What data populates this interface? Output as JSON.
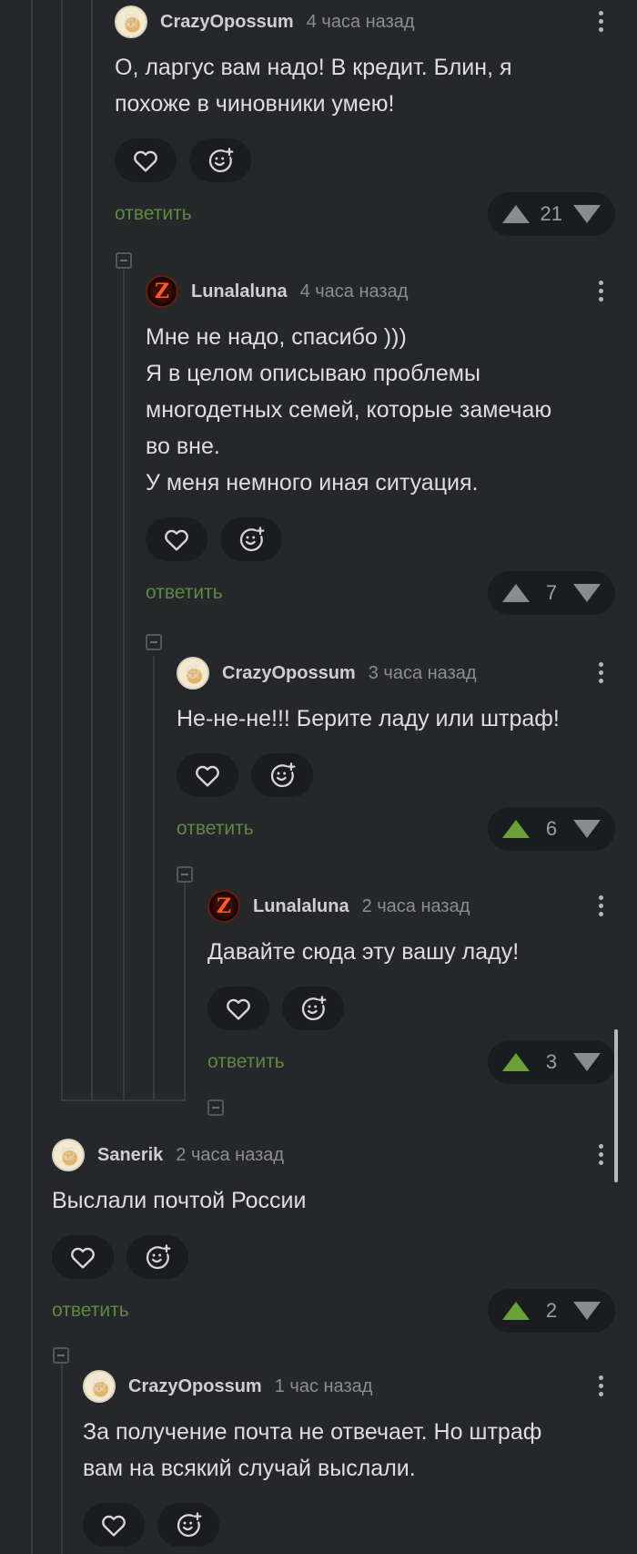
{
  "comments": [
    {
      "author": "CrazyOpossum",
      "time": "4 часа назад",
      "avatar": "possum-avatar",
      "lines": [
        "О, ларгус вам надо! В кредит. Блин, я",
        "похоже в чиновники умею!"
      ],
      "reply": "ответить",
      "rating": "21",
      "upvoted": false
    },
    {
      "author": "Lunalaluna",
      "time": "4 часа назад",
      "avatar": "z-logo-avatar",
      "avatar_letter": "Z",
      "lines": [
        "Мне не надо, спасибо )))",
        "Я в целом описываю проблемы",
        "многодетных семей, которые замечаю",
        "во вне.",
        "У меня немного иная ситуация."
      ],
      "reply": "ответить",
      "rating": "7",
      "upvoted": false
    },
    {
      "author": "CrazyOpossum",
      "time": "3 часа назад",
      "avatar": "possum-avatar",
      "lines": [
        "Не-не-не!!! Берите ладу или штраф!"
      ],
      "reply": "ответить",
      "rating": "6",
      "upvoted": true
    },
    {
      "author": "Lunalaluna",
      "time": "2 часа назад",
      "avatar": "z-logo-avatar",
      "avatar_letter": "Z",
      "lines": [
        "Давайте сюда эту вашу ладу!"
      ],
      "reply": "ответить",
      "rating": "3",
      "upvoted": true
    },
    {
      "author": "Sanerik",
      "time": "2 часа назад",
      "avatar": "possum-avatar",
      "lines": [
        "Выслали почтой России"
      ],
      "reply": "ответить",
      "rating": "2",
      "upvoted": true
    },
    {
      "author": "CrazyOpossum",
      "time": "1 час назад",
      "avatar": "possum-avatar",
      "lines": [
        "За получение почта не отвечает. Но штраф",
        "вам на всякий случай выслали."
      ]
    }
  ],
  "colors": {
    "background": "#26272b",
    "reply_link": "#5c8a3e",
    "upvote_active": "#6aa23a",
    "button_bg": "#1b1c1f"
  },
  "icons": [
    "heart-icon",
    "emoji-add-icon",
    "arrow-up-icon",
    "arrow-down-icon",
    "more-vertical-icon",
    "collapse-thread-icon"
  ]
}
